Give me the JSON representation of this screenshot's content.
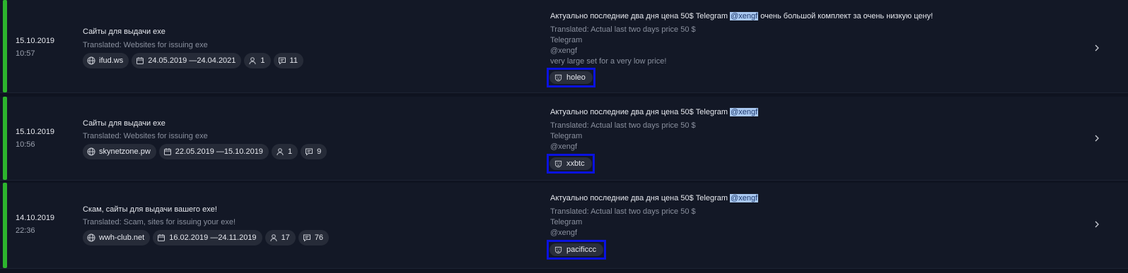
{
  "items": [
    {
      "date": "15.10.2019",
      "time": "10:57",
      "title": "Сайты для выдачи exe",
      "translated": "Translated: Websites for issuing exe",
      "forum": "ifud.ws",
      "period": "24.05.2019 —24.04.2021",
      "users": "1",
      "posts": "11",
      "message_pre": "Актуально последние два дня цена 50$ Telegram ",
      "message_handle": "@xengf",
      "message_post": " очень большой комплект за очень низкую цену!",
      "translated_message": "Translated: Actual last two days price 50 $",
      "translated_lines": [
        "Telegram",
        "@xengf",
        "very large set for a very low price!"
      ],
      "author": "holeo"
    },
    {
      "date": "15.10.2019",
      "time": "10:56",
      "title": "Сайты для выдачи exe",
      "translated": "Translated: Websites for issuing exe",
      "forum": "skynetzone.pw",
      "period": "22.05.2019 —15.10.2019",
      "users": "1",
      "posts": "9",
      "message_pre": "Актуально последние два дня цена 50$ Telegram ",
      "message_handle": "@xengf",
      "message_post": "",
      "translated_message": "Translated: Actual last two days price 50 $",
      "translated_lines": [
        "Telegram",
        "@xengf"
      ],
      "author": "xxbtc"
    },
    {
      "date": "14.10.2019",
      "time": "22:36",
      "title": "Скам, сайты для выдачи вашего exe!",
      "translated": "Translated: Scam, sites for issuing your exe!",
      "forum": "wwh-club.net",
      "period": "16.02.2019 —24.11.2019",
      "users": "17",
      "posts": "76",
      "message_pre": "Актуально последние два дня цена 50$ Telegram ",
      "message_handle": "@xengf",
      "message_post": "",
      "translated_message": "Translated: Actual last two days price 50 $",
      "translated_lines": [
        "Telegram",
        "@xengf"
      ],
      "author": "pacificcc"
    }
  ],
  "colors": {
    "background": "#0f1320",
    "row": "#131826",
    "accent": "#2db52d",
    "highlight": "#a9c8f0",
    "author_outline": "#0a12e0"
  },
  "icons": [
    "globe-icon",
    "calendar-icon",
    "user-icon",
    "comment-icon",
    "mask-icon",
    "chevron-right-icon"
  ]
}
